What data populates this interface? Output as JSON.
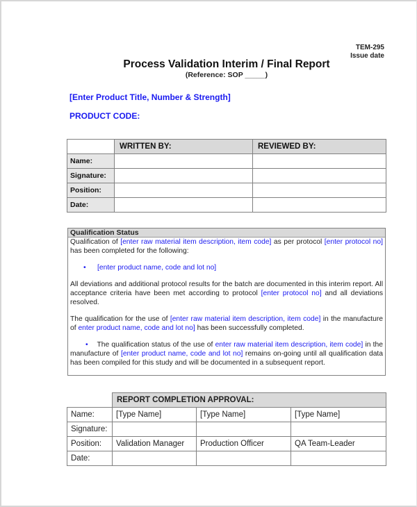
{
  "header": {
    "template_code": "TEM-295",
    "issue_date_label": "Issue date",
    "title": "Process Validation Interim / Final Report",
    "subtitle": "(Reference: SOP _____)"
  },
  "product": {
    "title_placeholder": "[Enter Product Title, Number & Strength]",
    "code_label": "PRODUCT CODE:"
  },
  "authorship_table": {
    "columns": [
      "WRITTEN BY:",
      "REVIEWED BY:"
    ],
    "rows": [
      {
        "label": "Name:",
        "written": "",
        "reviewed": ""
      },
      {
        "label": "Signature:",
        "written": "",
        "reviewed": ""
      },
      {
        "label": "Position:",
        "written": "",
        "reviewed": ""
      },
      {
        "label": "Date:",
        "written": "",
        "reviewed": ""
      }
    ]
  },
  "qualification": {
    "heading": "Qualification Status",
    "p1": {
      "a": "Qualification of ",
      "b": "[enter raw material item description, item code]",
      "c": " as per protocol ",
      "d": "[enter protocol no]",
      "e": " has been completed for the following:"
    },
    "bullet1": "[enter product name, code and lot no]",
    "p2": {
      "a": "All deviations and additional protocol results for the batch are documented in this interim report. All acceptance criteria have been met according to protocol ",
      "b": "[enter protocol no]",
      "c": " and all deviations resolved."
    },
    "p3": {
      "a": "The qualification for the use of ",
      "b": "[enter raw material item description, item code]",
      "c": " in the manufacture of ",
      "d": "enter product name, code and lot no]",
      "e": " has been successfully completed."
    },
    "p4": {
      "bullet": "•",
      "a": "The qualification status of the use of ",
      "b": "enter raw material item description, item code]",
      "c": " in the manufacture of ",
      "d": "[enter product name, code and lot no]",
      "e": " remains on-going until all qualification data has been compiled for this study and will be documented in a subsequent report."
    }
  },
  "approval_table": {
    "heading": "REPORT COMPLETION APPROVAL:",
    "rows": [
      {
        "label": "Name:",
        "values": [
          "[Type Name]",
          "[Type Name]",
          "[Type Name]"
        ]
      },
      {
        "label": "Signature:",
        "values": [
          "",
          "",
          ""
        ]
      },
      {
        "label": "Position:",
        "values": [
          "Validation Manager",
          "Production Officer",
          "QA Team-Leader"
        ]
      },
      {
        "label": "Date:",
        "values": [
          "",
          "",
          ""
        ]
      }
    ]
  },
  "colors": {
    "placeholder_blue": "#1a1af0",
    "header_fill": "#d9d9d9",
    "label_fill": "#e6e6e6"
  }
}
